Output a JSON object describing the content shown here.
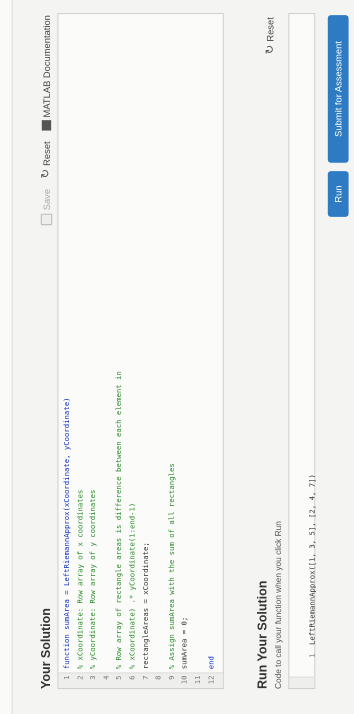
{
  "solution": {
    "title": "Your Solution",
    "toolbar": {
      "save_label": "Save",
      "reset_label": "Reset",
      "doc_label": "MATLAB Documentation"
    },
    "code_lines": [
      {
        "num": "1",
        "text": "function sumArea = LeftRiemannApprox(xCoordinate, yCoordinate)"
      },
      {
        "num": "2",
        "text": "% xCoordinate: Row array of x coordinates"
      },
      {
        "num": "3",
        "text": "% yCoordinate: Row array of y coordinates"
      },
      {
        "num": "4",
        "text": ""
      },
      {
        "num": "5",
        "text": "% Row array of rectangle areas is difference between each element in"
      },
      {
        "num": "6",
        "text": "% xCoordinate) .* yCoordinate(1:end-1)"
      },
      {
        "num": "7",
        "text": "rectangleAreas = xCoordinate;"
      },
      {
        "num": "8",
        "text": ""
      },
      {
        "num": "9",
        "text": "% Assign sumArea with the sum of all rectangles"
      },
      {
        "num": "10",
        "text": "sumArea = 0;"
      },
      {
        "num": "11",
        "text": ""
      },
      {
        "num": "12",
        "text": "end"
      }
    ]
  },
  "run": {
    "title": "Run Your Solution",
    "hint": "Code to call your function when you click Run",
    "reset_label": "Reset",
    "code_num": "1",
    "code_text": "LeftRiemannApprox([1, 3, 5], [2, 4, 7])",
    "run_label": "Run",
    "submit_label": "Submit for Assessment"
  }
}
